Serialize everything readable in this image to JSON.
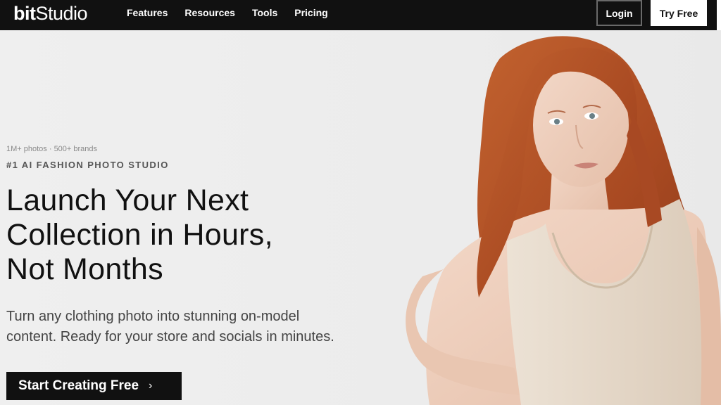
{
  "nav": {
    "logo_bold": "bit",
    "logo_light": "Studio",
    "links": [
      "Features",
      "Resources",
      "Tools",
      "Pricing"
    ],
    "login": "Login",
    "try_free": "Try Free"
  },
  "hero": {
    "stats": "1M+ photos · 500+ brands",
    "eyebrow": "#1 AI FASHION PHOTO STUDIO",
    "headline_line1": "Launch Your Next",
    "headline_line2": "Collection in Hours,",
    "headline_line3": "Not Months",
    "subtext_line1": "Turn any clothing photo into stunning on-model",
    "subtext_line2": "content. Ready for your store and socials in minutes.",
    "cta_label": "Start Creating Free",
    "cta_icon": "chevron-right-icon"
  },
  "colors": {
    "nav_bg": "#111111",
    "hero_bg": "#eeeeee",
    "text_dark": "#111111",
    "hair": "#b5532a",
    "skin": "#efcfbd",
    "top": "#e8dccd"
  }
}
